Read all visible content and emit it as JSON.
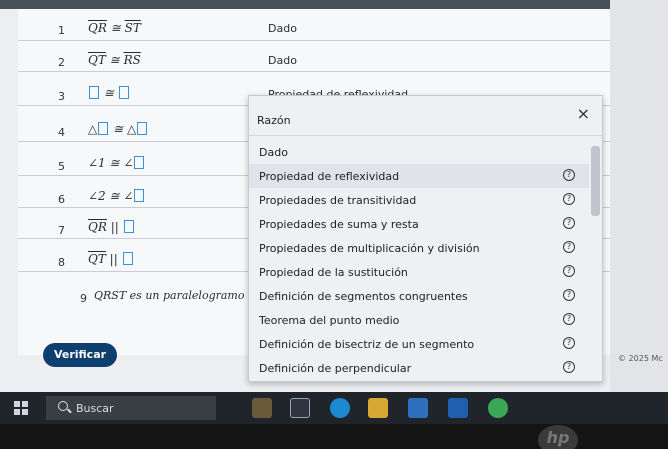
{
  "proof": {
    "rows": [
      {
        "num": "1",
        "stmt_a": "QR",
        "op": "≅",
        "stmt_b": "ST",
        "reason": "Dado"
      },
      {
        "num": "2",
        "stmt_a": "QT",
        "op": "≅",
        "stmt_b": "RS",
        "reason": "Dado"
      },
      {
        "num": "3",
        "op": "≅",
        "reason": "Propiedad de reflexividad"
      },
      {
        "num": "4",
        "prefix": "△",
        "op": "≅",
        "prefix2": "△"
      },
      {
        "num": "5",
        "prefix": "∠1",
        "op": "≅",
        "prefix2": "∠"
      },
      {
        "num": "6",
        "prefix": "∠2",
        "op": "≅",
        "prefix2": "∠"
      },
      {
        "num": "7",
        "stmt_a": "QR",
        "op": "||"
      },
      {
        "num": "8",
        "stmt_a": "QT",
        "op": "||"
      },
      {
        "num": "9",
        "stmt": "QRST es un paralelogramo"
      }
    ]
  },
  "dropdown": {
    "title": "Razón",
    "close": "×",
    "help_glyph": "?",
    "options": [
      "Dado",
      "Propiedad de reflexividad",
      "Propiedades de transitividad",
      "Propiedades de suma y resta",
      "Propiedades de multiplicación y división",
      "Propiedad de la sustitución",
      "Definición de segmentos congruentes",
      "Teorema del punto medio",
      "Definición de bisectriz de un segmento",
      "Definición de perpendicular"
    ]
  },
  "verify_label": "Verificar",
  "copyright": "© 2025 Mc",
  "taskbar": {
    "search_placeholder": "Buscar"
  },
  "brand": "hp"
}
